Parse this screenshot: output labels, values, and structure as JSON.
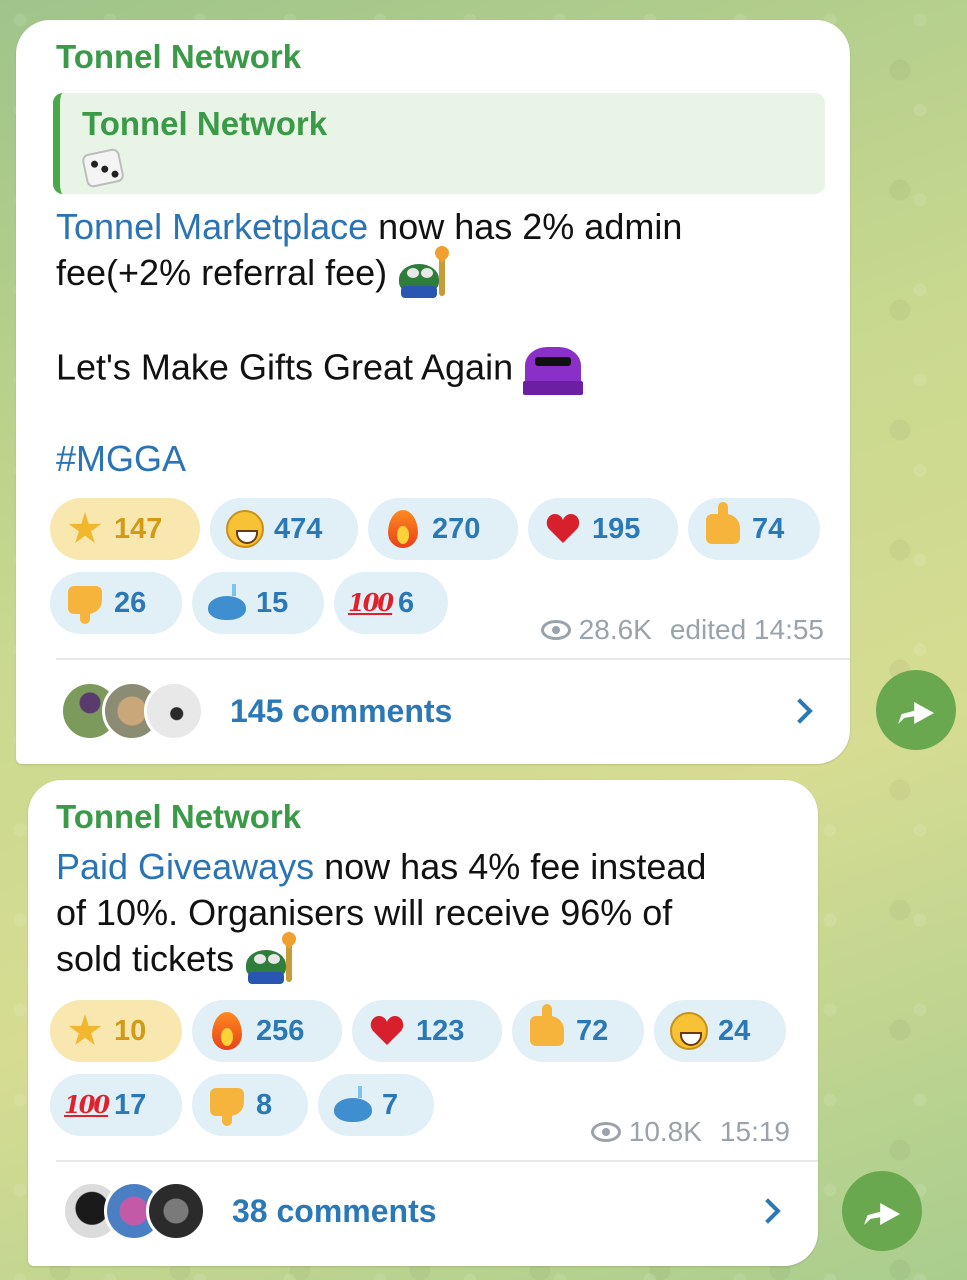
{
  "messages": [
    {
      "author": "Tonnel Network",
      "reply": {
        "title": "Tonnel Network",
        "icon": "dice-icon"
      },
      "text_link": "Tonnel Marketplace",
      "text_rest1": " now has 2% admin",
      "text_line2": "fee(+2% referral fee)",
      "text_line3": "Let's Make Gifts Great Again",
      "hashtag": "#MGGA",
      "reactions": [
        {
          "icon": "star-icon",
          "count": "147"
        },
        {
          "icon": "grin-icon",
          "count": "474"
        },
        {
          "icon": "fire-icon",
          "count": "270"
        },
        {
          "icon": "heart-icon",
          "count": "195"
        },
        {
          "icon": "thumbs-up-icon",
          "count": "74"
        },
        {
          "icon": "thumbs-down-icon",
          "count": "26"
        },
        {
          "icon": "whale-icon",
          "count": "15"
        },
        {
          "icon": "hundred-icon",
          "count": "6"
        }
      ],
      "views": "28.6K",
      "time": "edited 14:55",
      "comments": "145 comments"
    },
    {
      "author": "Tonnel Network",
      "text_link": "Paid Giveaways",
      "text_rest1": " now has 4% fee instead",
      "text_line2": "of 10%. Organisers will receive 96% of",
      "text_line3": "sold tickets",
      "reactions": [
        {
          "icon": "star-icon",
          "count": "10"
        },
        {
          "icon": "fire-icon",
          "count": "256"
        },
        {
          "icon": "heart-icon",
          "count": "123"
        },
        {
          "icon": "thumbs-up-icon",
          "count": "72"
        },
        {
          "icon": "grin-icon",
          "count": "24"
        },
        {
          "icon": "hundred-icon",
          "count": "17"
        },
        {
          "icon": "thumbs-down-icon",
          "count": "8"
        },
        {
          "icon": "whale-icon",
          "count": "7"
        }
      ],
      "views": "10.8K",
      "time": "15:19",
      "comments": "38 comments"
    }
  ],
  "hundred_glyph": "100",
  "colors": {
    "accent": "#2b78b6",
    "author": "#3a9a47",
    "share": "#6aa84f"
  }
}
